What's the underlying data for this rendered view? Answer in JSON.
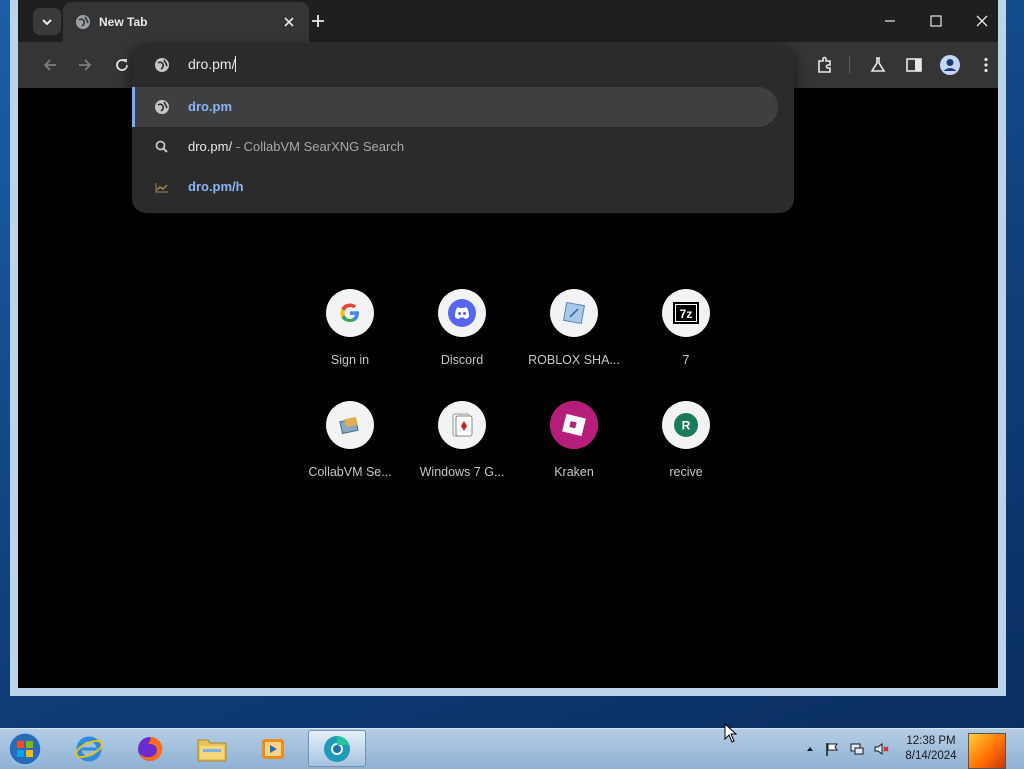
{
  "browser": {
    "tab": {
      "title": "New Tab",
      "favicon": "globe-icon"
    },
    "toolbar": {
      "icons": [
        "back-icon",
        "forward-icon",
        "reload-icon",
        "extensions-icon",
        "labs-flask-icon",
        "side-panel-icon",
        "profile-icon",
        "more-menu-icon"
      ]
    },
    "omnibox": {
      "input_value": "dro.pm/",
      "suggestions": [
        {
          "icon": "globe-icon",
          "url": "dro.pm",
          "desc": "",
          "selected": true
        },
        {
          "icon": "search-icon",
          "url": "dro.pm/",
          "desc": "- CollabVM SearXNG Search",
          "selected": false
        },
        {
          "icon": "history-icon",
          "url": "dro.pm/h",
          "desc": "",
          "selected": false
        }
      ]
    }
  },
  "shortcuts": [
    {
      "label": "Sign in",
      "icon": "google-icon"
    },
    {
      "label": "Discord",
      "icon": "discord-icon"
    },
    {
      "label": "ROBLOX SHA...",
      "icon": "roblox-shader-icon"
    },
    {
      "label": "7",
      "icon": "7zip-icon"
    },
    {
      "label": "CollabVM Se...",
      "icon": "collabvm-icon"
    },
    {
      "label": "Windows 7 G...",
      "icon": "cards-icon"
    },
    {
      "label": "Kraken",
      "icon": "kraken-icon"
    },
    {
      "label": "recive",
      "icon": "r-letter-icon",
      "letter": "R"
    }
  ],
  "taskbar": {
    "apps": [
      "internet-explorer-icon",
      "firefox-icon",
      "file-explorer-icon",
      "media-player-icon",
      "chromium-icon"
    ],
    "clock": {
      "time": "12:38 PM",
      "date": "8/14/2024"
    }
  },
  "colors": {
    "accent": "#8ab4f8",
    "page_bg": "#000000",
    "omnibox_bg": "#2b2b2c"
  }
}
